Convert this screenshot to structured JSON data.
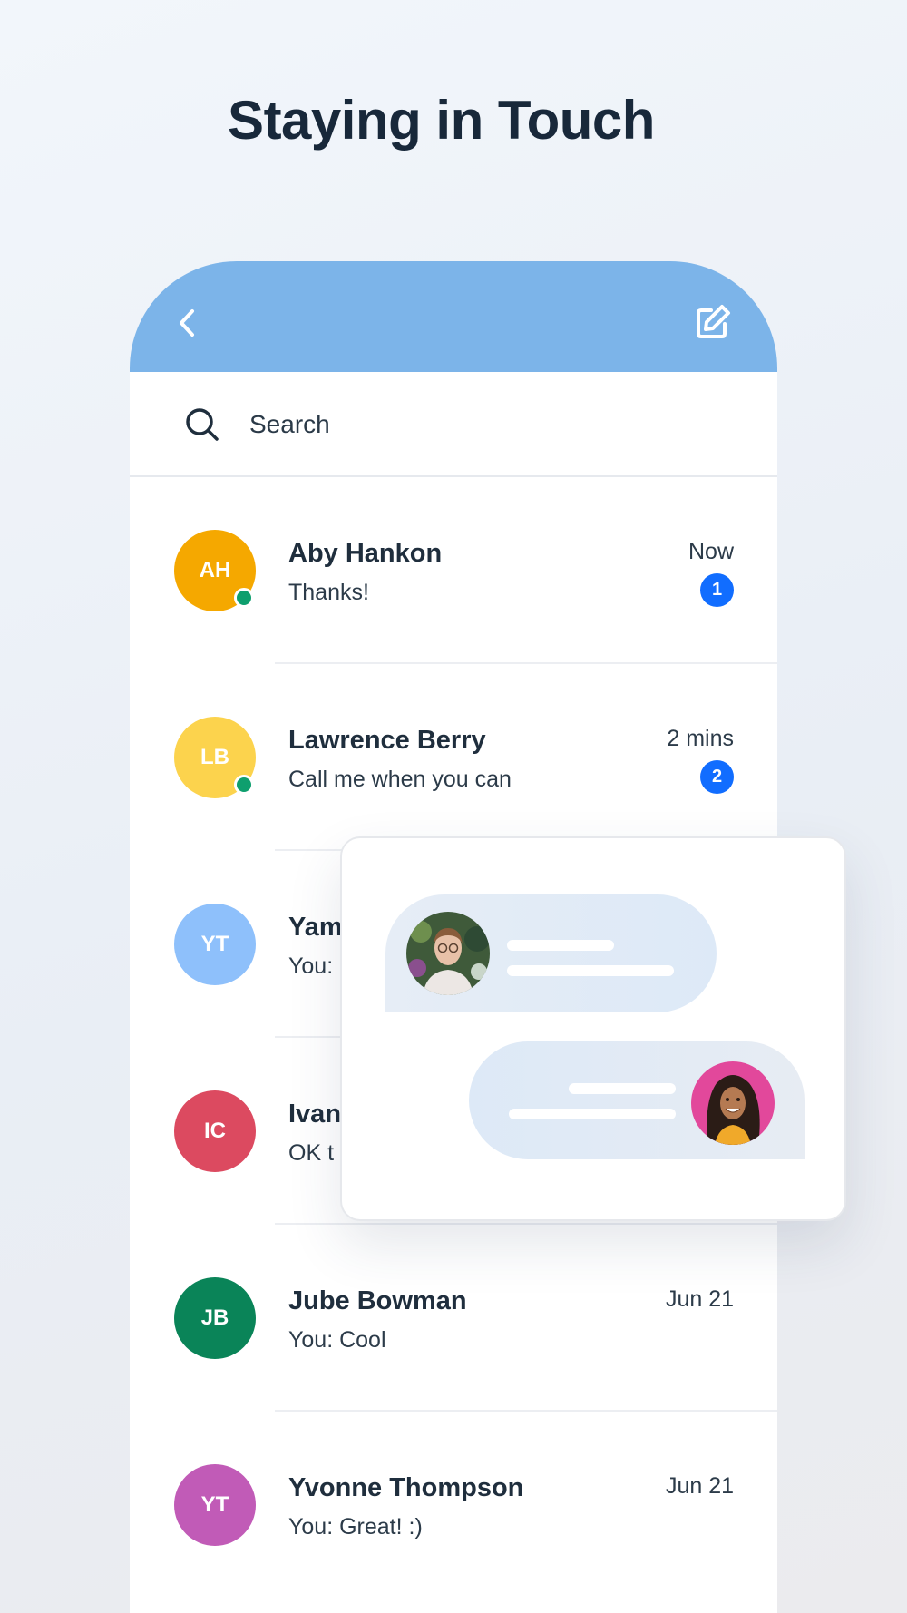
{
  "headline": "Staying in Touch",
  "header": {
    "back_icon": "chevron-left-icon",
    "compose_icon": "compose-edit-icon",
    "color": "#7cb4e9"
  },
  "search": {
    "placeholder": "Search",
    "icon": "search-icon"
  },
  "conversations": [
    {
      "initials": "AH",
      "name": "Aby Hankon",
      "message": "Thanks!",
      "time": "Now",
      "unread": "1",
      "online": true,
      "avatar_color": "#f5a800"
    },
    {
      "initials": "LB",
      "name": "Lawrence Berry",
      "message": "Call me when you can",
      "time": "2 mins",
      "unread": "2",
      "online": true,
      "avatar_color": "#fcd34d"
    },
    {
      "initials": "YT",
      "name": "Yam",
      "message": "You:",
      "time": "",
      "unread": "",
      "online": false,
      "avatar_color": "#8ec0fb"
    },
    {
      "initials": "IC",
      "name": "Ivan",
      "message": "OK t",
      "time": "",
      "unread": "",
      "online": false,
      "avatar_color": "#dc4a60"
    },
    {
      "initials": "JB",
      "name": "Jube Bowman",
      "message": "You: Cool",
      "time": "Jun 21",
      "unread": "",
      "online": false,
      "avatar_color": "#0a8458"
    },
    {
      "initials": "YT",
      "name": "Yvonne Thompson",
      "message": "You: Great! :)",
      "time": "Jun 21",
      "unread": "",
      "online": false,
      "avatar_color": "#c15bb7"
    }
  ],
  "chat_preview": {
    "incoming_avatar": "woman-with-glasses-photo",
    "outgoing_avatar": "smiling-woman-photo",
    "badge_color": "#116dff"
  }
}
